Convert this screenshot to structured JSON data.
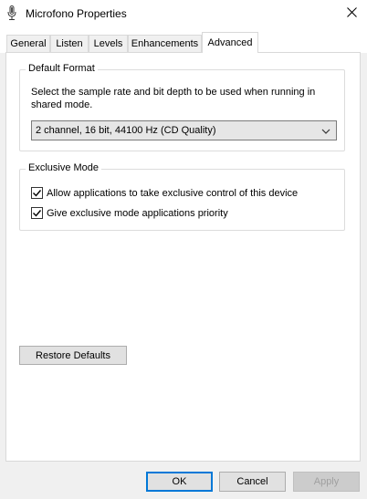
{
  "window": {
    "title": "Microfono Properties",
    "icons": {
      "app": "microphone-icon",
      "close": "close-icon"
    }
  },
  "tabs": [
    {
      "label": "General"
    },
    {
      "label": "Listen"
    },
    {
      "label": "Levels"
    },
    {
      "label": "Enhancements"
    },
    {
      "label": "Advanced",
      "active": true
    }
  ],
  "default_format": {
    "heading": "Default Format",
    "description": "Select the sample rate and bit depth to be used when running in shared mode.",
    "selected_value": "2 channel, 16 bit, 44100 Hz (CD Quality)"
  },
  "exclusive_mode": {
    "heading": "Exclusive Mode",
    "options": [
      {
        "label": "Allow applications to take exclusive control of this device",
        "checked": true
      },
      {
        "label": "Give exclusive mode applications priority",
        "checked": true
      }
    ]
  },
  "restore_label": "Restore Defaults",
  "buttons": {
    "ok": "OK",
    "cancel": "Cancel",
    "apply": "Apply"
  },
  "colors": {
    "accent": "#0078d7",
    "disabled_text": "#a0a0a0"
  }
}
